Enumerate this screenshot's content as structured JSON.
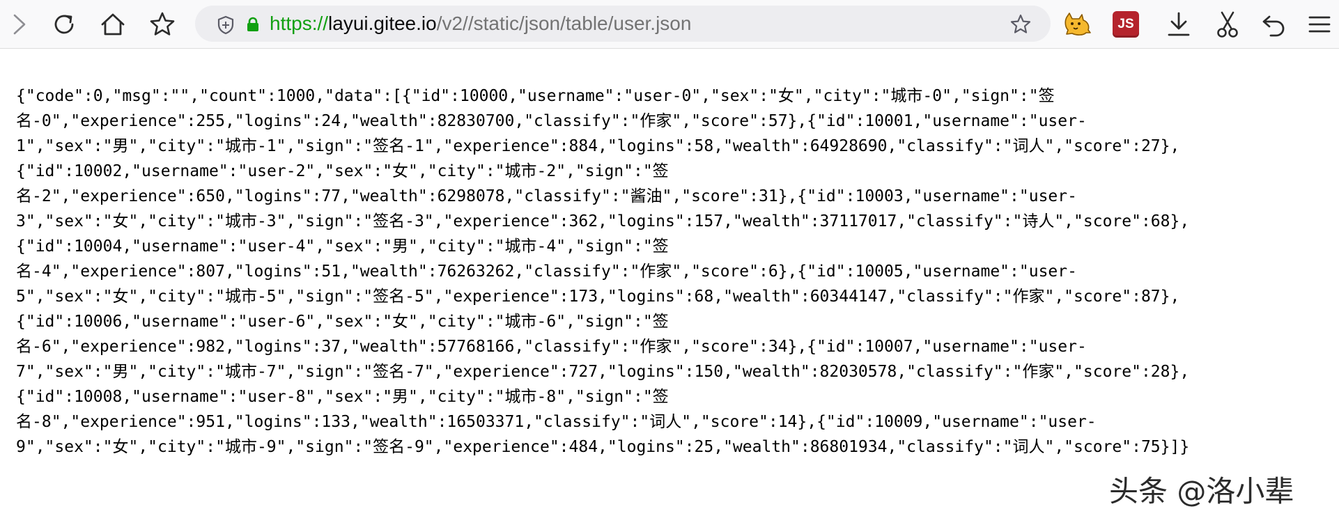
{
  "browser": {
    "url": {
      "scheme": "https://",
      "host": "layui.gitee.io",
      "path": "/v2//static/json/table/user.json"
    },
    "icons": {
      "forward": "chevron-right-icon",
      "reload": "reload-icon",
      "home": "home-icon",
      "bookmark": "star-outline-icon",
      "page_info": "shield-icon",
      "secure": "lock-icon",
      "bookmark_page": "star-outline-icon",
      "extension_1": "tampermonkey-cat-icon",
      "download": "download-icon",
      "screenshot": "scissors-icon",
      "undo": "undo-icon",
      "menu": "hamburger-menu-icon"
    },
    "extension_js_label": "JS",
    "colors": {
      "secure_green": "#12a012",
      "js_badge_red": "#b5232c"
    }
  },
  "page": {
    "json_text": "{\"code\":0,\"msg\":\"\",\"count\":1000,\"data\":[{\"id\":10000,\"username\":\"user-0\",\"sex\":\"女\",\"city\":\"城市-0\",\"sign\":\"签\n名-0\",\"experience\":255,\"logins\":24,\"wealth\":82830700,\"classify\":\"作家\",\"score\":57},{\"id\":10001,\"username\":\"user-\n1\",\"sex\":\"男\",\"city\":\"城市-1\",\"sign\":\"签名-1\",\"experience\":884,\"logins\":58,\"wealth\":64928690,\"classify\":\"词人\",\"score\":27},\n{\"id\":10002,\"username\":\"user-2\",\"sex\":\"女\",\"city\":\"城市-2\",\"sign\":\"签\n名-2\",\"experience\":650,\"logins\":77,\"wealth\":6298078,\"classify\":\"酱油\",\"score\":31},{\"id\":10003,\"username\":\"user-\n3\",\"sex\":\"女\",\"city\":\"城市-3\",\"sign\":\"签名-3\",\"experience\":362,\"logins\":157,\"wealth\":37117017,\"classify\":\"诗人\",\"score\":68},\n{\"id\":10004,\"username\":\"user-4\",\"sex\":\"男\",\"city\":\"城市-4\",\"sign\":\"签\n名-4\",\"experience\":807,\"logins\":51,\"wealth\":76263262,\"classify\":\"作家\",\"score\":6},{\"id\":10005,\"username\":\"user-\n5\",\"sex\":\"女\",\"city\":\"城市-5\",\"sign\":\"签名-5\",\"experience\":173,\"logins\":68,\"wealth\":60344147,\"classify\":\"作家\",\"score\":87},\n{\"id\":10006,\"username\":\"user-6\",\"sex\":\"女\",\"city\":\"城市-6\",\"sign\":\"签\n名-6\",\"experience\":982,\"logins\":37,\"wealth\":57768166,\"classify\":\"作家\",\"score\":34},{\"id\":10007,\"username\":\"user-\n7\",\"sex\":\"男\",\"city\":\"城市-7\",\"sign\":\"签名-7\",\"experience\":727,\"logins\":150,\"wealth\":82030578,\"classify\":\"作家\",\"score\":28},\n{\"id\":10008,\"username\":\"user-8\",\"sex\":\"男\",\"city\":\"城市-8\",\"sign\":\"签\n名-8\",\"experience\":951,\"logins\":133,\"wealth\":16503371,\"classify\":\"词人\",\"score\":14},{\"id\":10009,\"username\":\"user-\n9\",\"sex\":\"女\",\"city\":\"城市-9\",\"sign\":\"签名-9\",\"experience\":484,\"logins\":25,\"wealth\":86801934,\"classify\":\"词人\",\"score\":75}]}"
  },
  "watermark": {
    "text": "头条 @洛小辈"
  }
}
